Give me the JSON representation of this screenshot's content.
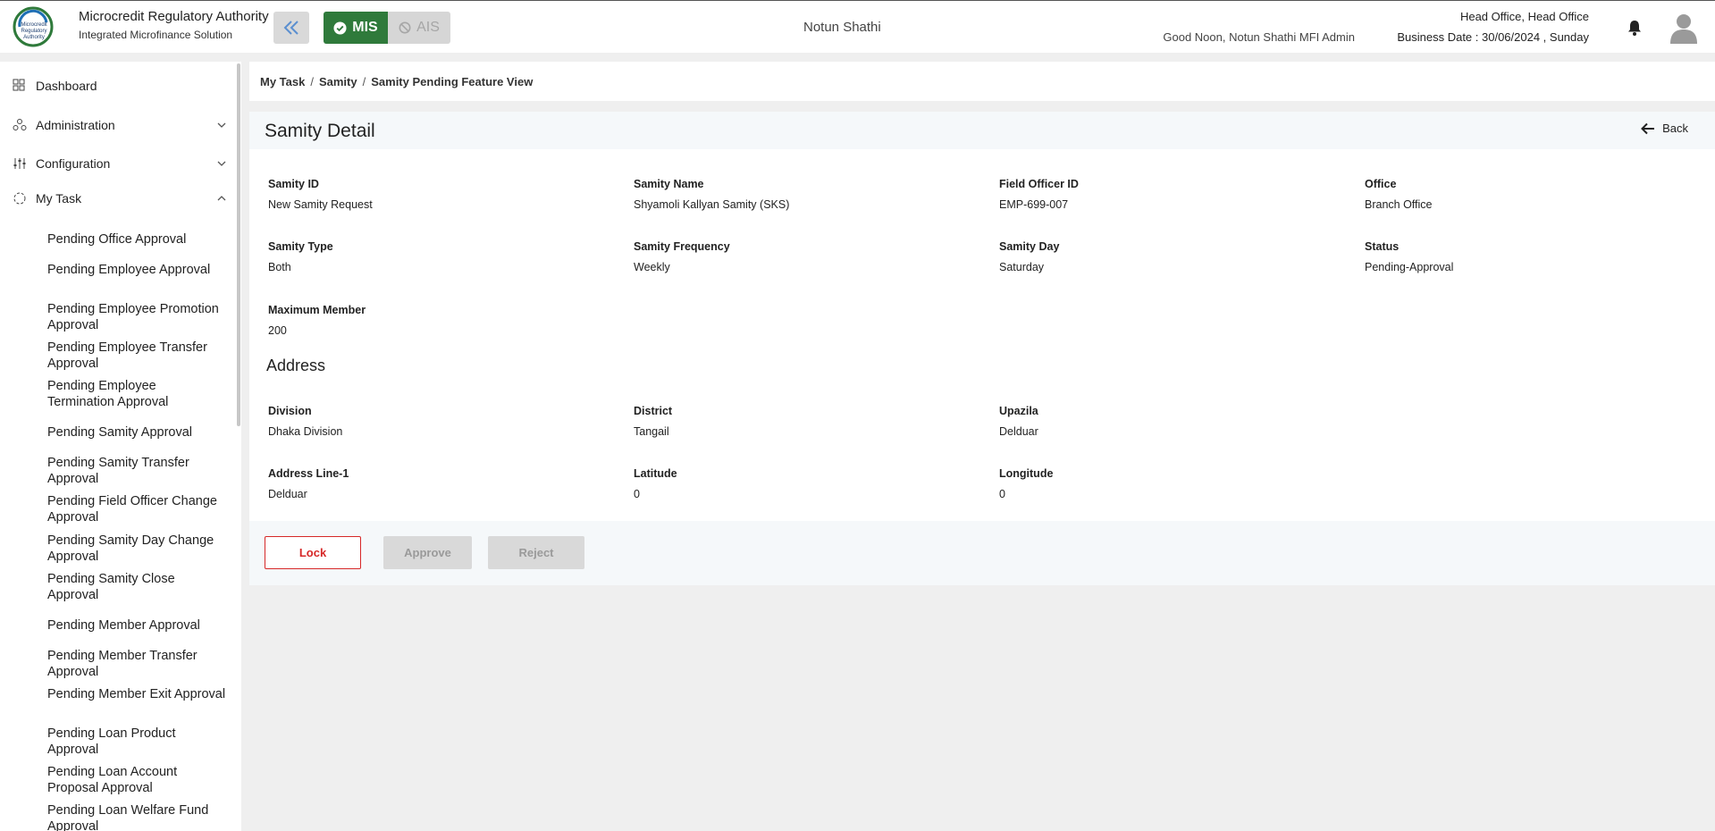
{
  "header": {
    "brand_title": "Microcredit Regulatory Authority",
    "brand_subtitle": "Integrated Microfinance Solution",
    "logo_text": "Microcredit Regulatory Authority",
    "mis_label": "MIS",
    "ais_label": "AIS",
    "org_name": "Notun Shathi",
    "greeting": "Good Noon, Notun Shathi MFI Admin",
    "office": "Head Office, Head Office",
    "business_date": "Business Date : 30/06/2024 , Sunday",
    "colors": {
      "mis_active": "#2f7a3b",
      "accent_blue": "#4a90d9"
    }
  },
  "sidebar": {
    "items": [
      {
        "label": "Dashboard",
        "icon": "grid-icon"
      },
      {
        "label": "Administration",
        "icon": "users-icon"
      },
      {
        "label": "Configuration",
        "icon": "sliders-icon"
      },
      {
        "label": "My Task",
        "icon": "refresh-icon"
      }
    ],
    "my_task_subitems": [
      "Pending Office Approval",
      "Pending Employee Approval",
      "Pending Employee Promotion Approval",
      "Pending Employee Transfer Approval",
      "Pending Employee Termination Approval",
      "Pending Samity Approval",
      "Pending Samity Transfer Approval",
      "Pending Field Officer Change Approval",
      "Pending Samity Day Change Approval",
      "Pending Samity Close Approval",
      "Pending Member Approval",
      "Pending Member Transfer Approval",
      "Pending Member Exit Approval",
      "Pending Loan Product Approval",
      "Pending Loan Account Proposal Approval",
      "Pending Loan Welfare Fund Approval"
    ]
  },
  "breadcrumb": [
    "My Task",
    "Samity",
    "Samity Pending Feature View"
  ],
  "detail": {
    "title": "Samity Detail",
    "back_label": "Back",
    "fields": [
      {
        "label": "Samity ID",
        "value": "New Samity Request"
      },
      {
        "label": "Samity Name",
        "value": "Shyamoli Kallyan Samity (SKS)"
      },
      {
        "label": "Field Officer ID",
        "value": "EMP-699-007"
      },
      {
        "label": "Office",
        "value": "Branch Office"
      },
      {
        "label": "Samity Type",
        "value": "Both"
      },
      {
        "label": "Samity Frequency",
        "value": "Weekly"
      },
      {
        "label": "Samity Day",
        "value": "Saturday"
      },
      {
        "label": "Status",
        "value": "Pending-Approval"
      },
      {
        "label": "Maximum Member",
        "value": "200"
      }
    ],
    "address_title": "Address",
    "address_fields": [
      {
        "label": "Division",
        "value": "Dhaka Division"
      },
      {
        "label": "District",
        "value": "Tangail"
      },
      {
        "label": "Upazila",
        "value": "Delduar"
      },
      {
        "label": "Address Line-1",
        "value": "Delduar"
      },
      {
        "label": "Latitude",
        "value": "0"
      },
      {
        "label": "Longitude",
        "value": "0"
      }
    ],
    "actions": {
      "lock": "Lock",
      "approve": "Approve",
      "reject": "Reject"
    }
  }
}
